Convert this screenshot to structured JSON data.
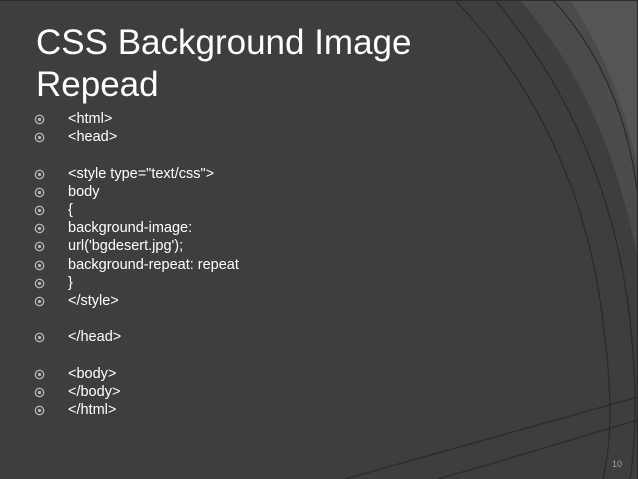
{
  "slide": {
    "title_line1": "CSS Background Image",
    "title_line2": "Repead",
    "bullets": [
      "<html>",
      "<head>",
      "<style type=\"text/css\">",
      "body",
      "{",
      "background-image:",
      "url('bgdesert.jpg');",
      "background-repeat: repeat",
      "}",
      "</style>",
      "</head>",
      "<body>",
      "</body>",
      "</html>"
    ],
    "bullet_icon": "circled-dot-icon",
    "page_number": "10"
  },
  "colors": {
    "background": "#3e3e3e",
    "text": "#ffffff",
    "bullet": "#b8b8b8",
    "page_number": "#a0a0a0"
  }
}
